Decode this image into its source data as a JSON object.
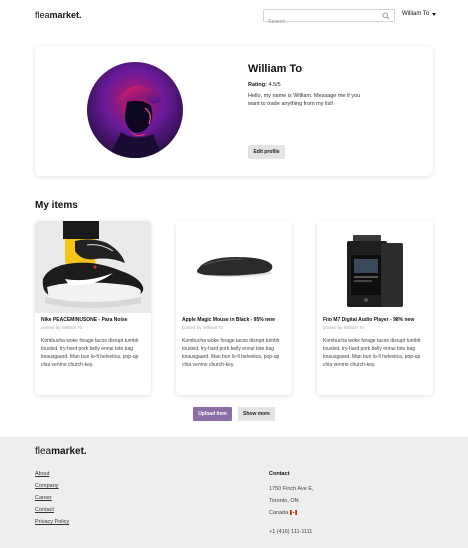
{
  "header": {
    "logo_light": "flea",
    "logo_bold": "market.",
    "search_placeholder": "Search",
    "user_name": "William To"
  },
  "profile": {
    "name": "William To",
    "rating_label": "Rating:",
    "rating_value": "4.5/5",
    "bio": "Hello, my name is William. Message me if you want to trade anything from my list!",
    "edit_button": "Edit profile"
  },
  "items_section": {
    "title": "My items",
    "items": [
      {
        "title": "Nike PEACEMINUSONE - Para Noise",
        "posted_by": "posted by William To",
        "description": "Kombucha woke forage tacos disrupt tumblr tousled, try-hard pork belly ennui tote bag knausgaard. Man bun lo-fi helvetica, pop-up chia venmo church-key."
      },
      {
        "title": "Apple Magic Mouse in Black - 95% new",
        "posted_by": "posted by William To",
        "description": "Kombucha woke forage tacos disrupt tumblr tousled, try-hard pork belly ennui tote bag knausgaard. Man bun lo-fi helvetica, pop-up chia venmo church-key."
      },
      {
        "title": "Fiio M7 Digital Audio Player - 98% new",
        "posted_by": "posted by William To",
        "description": "Kombucha woke forage tacos disrupt tumblr tousled, try-hard pork belly ennui tote bag knausgaard. Man bun lo-fi helvetica, pop-up chia venmo church-key."
      }
    ],
    "upload_button": "Upload item",
    "more_button": "Show more"
  },
  "footer": {
    "logo_light": "flea",
    "logo_bold": "market.",
    "links": [
      "About",
      "Company",
      "Career",
      "Contact",
      "Privacy Policy"
    ],
    "contact": {
      "heading": "Contact",
      "address1": "1750 Finch Ave E,",
      "address2": "Toronto, ON",
      "country": "Canada",
      "phone": "+1 (416) 111-1111"
    }
  },
  "colors": {
    "accent": "#8b6fa4",
    "footer_bg": "#eeeeee",
    "button_gray": "#e3e3e3"
  }
}
